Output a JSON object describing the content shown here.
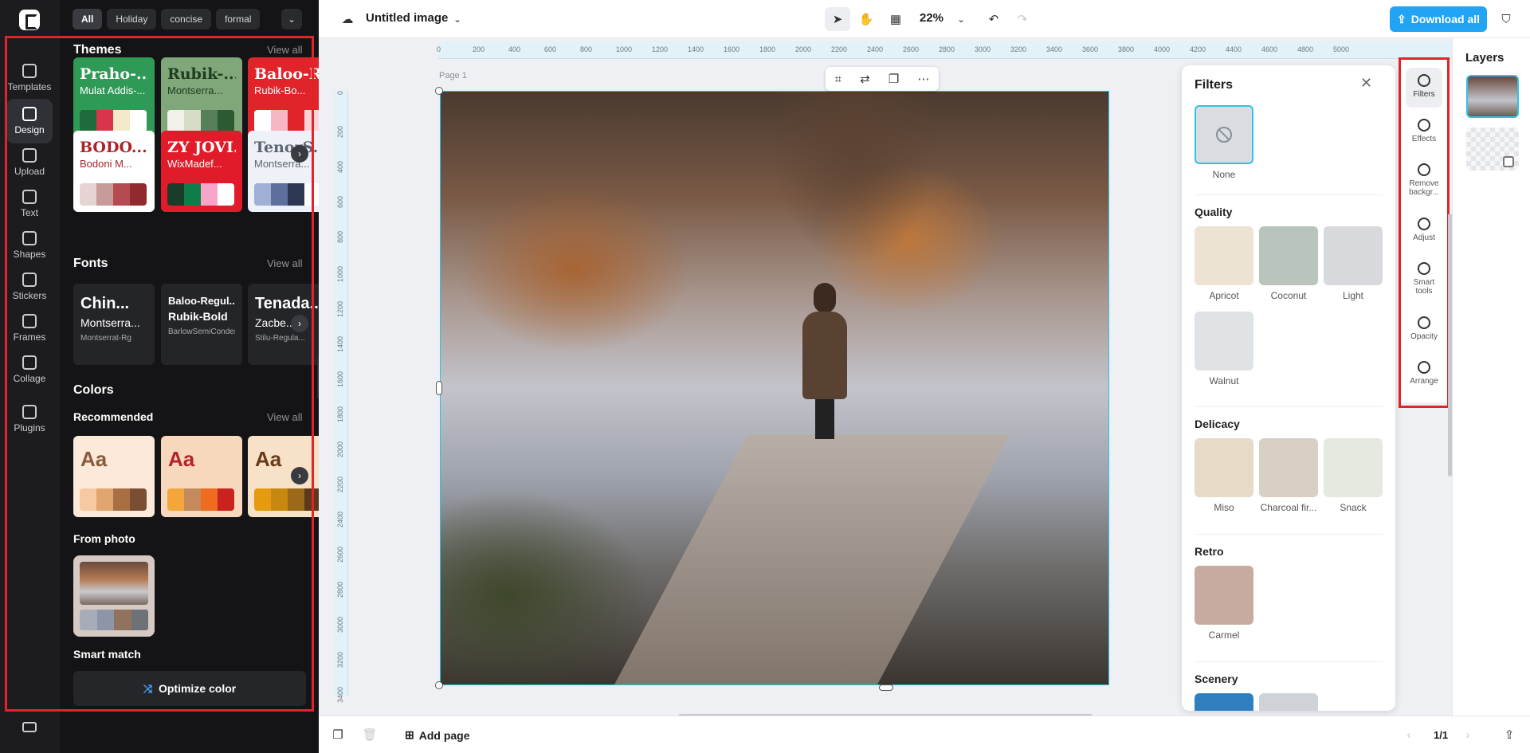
{
  "sidebar": {
    "items": [
      {
        "label": "Templates",
        "icon": "templates-icon"
      },
      {
        "label": "Design",
        "icon": "design-icon"
      },
      {
        "label": "Upload",
        "icon": "upload-icon"
      },
      {
        "label": "Text",
        "icon": "text-icon"
      },
      {
        "label": "Shapes",
        "icon": "shapes-icon"
      },
      {
        "label": "Stickers",
        "icon": "stickers-icon"
      },
      {
        "label": "Frames",
        "icon": "frames-icon"
      },
      {
        "label": "Collage",
        "icon": "collage-icon"
      },
      {
        "label": "Plugins",
        "icon": "plugins-icon"
      }
    ],
    "active": "Design"
  },
  "panel": {
    "chips": [
      "All",
      "Holiday",
      "concise",
      "formal"
    ],
    "themes": {
      "title": "Themes",
      "view_all": "View all",
      "cards": [
        {
          "t1": "Praho-...",
          "t2": "Mulat Addis-...",
          "bg": "#2e9a55",
          "fg": "#ffffff",
          "swatches": [
            "#1e6b3d",
            "#d8344c",
            "#f4e9c8",
            "#ffffff"
          ]
        },
        {
          "t1": "Rubik-...",
          "t2": "Montserra...",
          "bg": "#7fa77a",
          "fg": "#1f3b20",
          "swatches": [
            "#f1f1ea",
            "#d7dcc8",
            "#57805a",
            "#2e5a33"
          ]
        },
        {
          "t1": "Baloo-Regu...",
          "t2": "Rubik-Bo...",
          "bg": "#e0242a",
          "fg": "#ffffff",
          "swatches": [
            "#ffffff",
            "#f7b6c3",
            "#e0242a",
            "#ffd1d9"
          ]
        },
        {
          "t1": "BODO...",
          "t2": "Bodoni M...",
          "bg": "#ffffff",
          "fg": "#a8242a",
          "swatches": [
            "#e6d4d4",
            "#c99a9a",
            "#b54a50",
            "#8f2b2f"
          ]
        },
        {
          "t1": "ZY JOVI...",
          "t2": "WixMadef...",
          "bg": "#e11b2a",
          "fg": "#ffffff",
          "swatches": [
            "#1a3d2a",
            "#0f7d47",
            "#f7a6c9",
            "#ffffff"
          ]
        },
        {
          "t1": "TenorS...",
          "t2": "Montserra...",
          "bg": "#eef1f7",
          "fg": "#5c6470",
          "swatches": [
            "#9fb0d4",
            "#5d6f9d",
            "#2d3752",
            "#ffffff"
          ]
        }
      ]
    },
    "fonts": {
      "title": "Fonts",
      "view_all": "View all",
      "cards": [
        {
          "f1": "Chin...",
          "f2": "Montserra...",
          "f3": "Montserrat-Rg"
        },
        {
          "f1": "Baloo-Regul...",
          "f2": "Rubik-Bold",
          "f3": "BarlowSemiConden..."
        },
        {
          "f1": "Tenada...",
          "f2": "Zacbe...",
          "f3": "Stilu-Regula..."
        }
      ]
    },
    "colors": {
      "title": "Colors",
      "recommended": "Recommended",
      "view_all": "View all",
      "cards": [
        {
          "aa": "Aa",
          "bg": "#fde9d9",
          "fg": "#8a5a3a",
          "swatches": [
            "#f6c9a2",
            "#e2a56f",
            "#a86f45",
            "#7a4e33"
          ]
        },
        {
          "aa": "Aa",
          "bg": "#f8d8bd",
          "fg": "#b4232a",
          "swatches": [
            "#f3a73a",
            "#c58a5b",
            "#ef6b20",
            "#c8231f"
          ]
        },
        {
          "aa": "Aa",
          "bg": "#f7e2c8",
          "fg": "#6b3a1a",
          "swatches": [
            "#e59a0f",
            "#c8870f",
            "#9a6a1a",
            "#5a3a1a"
          ]
        }
      ],
      "from_photo": "From photo",
      "photo_swatches": [
        "#a7adb8",
        "#8c96a7",
        "#8f735f",
        "#6e7176"
      ],
      "smart_match": "Smart match",
      "optimize": "Optimize color"
    }
  },
  "topbar": {
    "title": "Untitled image",
    "zoom": "22%",
    "download": "Download all"
  },
  "canvas": {
    "page_label": "Page 1",
    "ruler_h": [
      "0",
      "200",
      "400",
      "600",
      "800",
      "1000",
      "1200",
      "1400",
      "1600",
      "1800",
      "2000",
      "2200",
      "2400",
      "2600",
      "2800",
      "3000",
      "3200",
      "3400",
      "3600",
      "3800",
      "4000",
      "4200",
      "4400",
      "4600",
      "4800",
      "5000"
    ],
    "ruler_v": [
      "0",
      "200",
      "400",
      "600",
      "800",
      "1000",
      "1200",
      "1400",
      "1600",
      "1800",
      "2000",
      "2200",
      "2400",
      "2600",
      "2800",
      "3000",
      "3200",
      "3400"
    ]
  },
  "filters": {
    "title": "Filters",
    "none_label": "None",
    "sections": [
      {
        "title": "Quality",
        "items": [
          {
            "label": "Apricot",
            "color": "#ece3d3"
          },
          {
            "label": "Coconut",
            "color": "#b9c4bd"
          },
          {
            "label": "Light",
            "color": "#d8d9dc"
          },
          {
            "label": "Walnut",
            "color": "#dfe3e6"
          }
        ]
      },
      {
        "title": "Delicacy",
        "items": [
          {
            "label": "Miso",
            "color": "#e7dbc8"
          },
          {
            "label": "Charcoal fir...",
            "color": "#d9cfc4"
          },
          {
            "label": "Snack",
            "color": "#e5e9e0"
          }
        ]
      },
      {
        "title": "Retro",
        "items": [
          {
            "label": "Carmel",
            "color": "#c8aba0"
          }
        ]
      },
      {
        "title": "Scenery",
        "items": []
      }
    ]
  },
  "tools": [
    {
      "label": "Filters",
      "icon": "filters-icon"
    },
    {
      "label": "Effects",
      "icon": "effects-icon"
    },
    {
      "label": "Remove backgr...",
      "icon": "remove-background-icon"
    },
    {
      "label": "Adjust",
      "icon": "adjust-icon"
    },
    {
      "label": "Smart tools",
      "icon": "smart-tools-icon"
    },
    {
      "label": "Opacity",
      "icon": "opacity-icon"
    },
    {
      "label": "Arrange",
      "icon": "arrange-icon"
    }
  ],
  "layers": {
    "title": "Layers"
  },
  "bottombar": {
    "add_page": "Add page",
    "page_count": "1/1"
  },
  "colors": {
    "accent": "#20a4f3",
    "highlight": "#e0242a",
    "selection": "#2ec2e6"
  }
}
